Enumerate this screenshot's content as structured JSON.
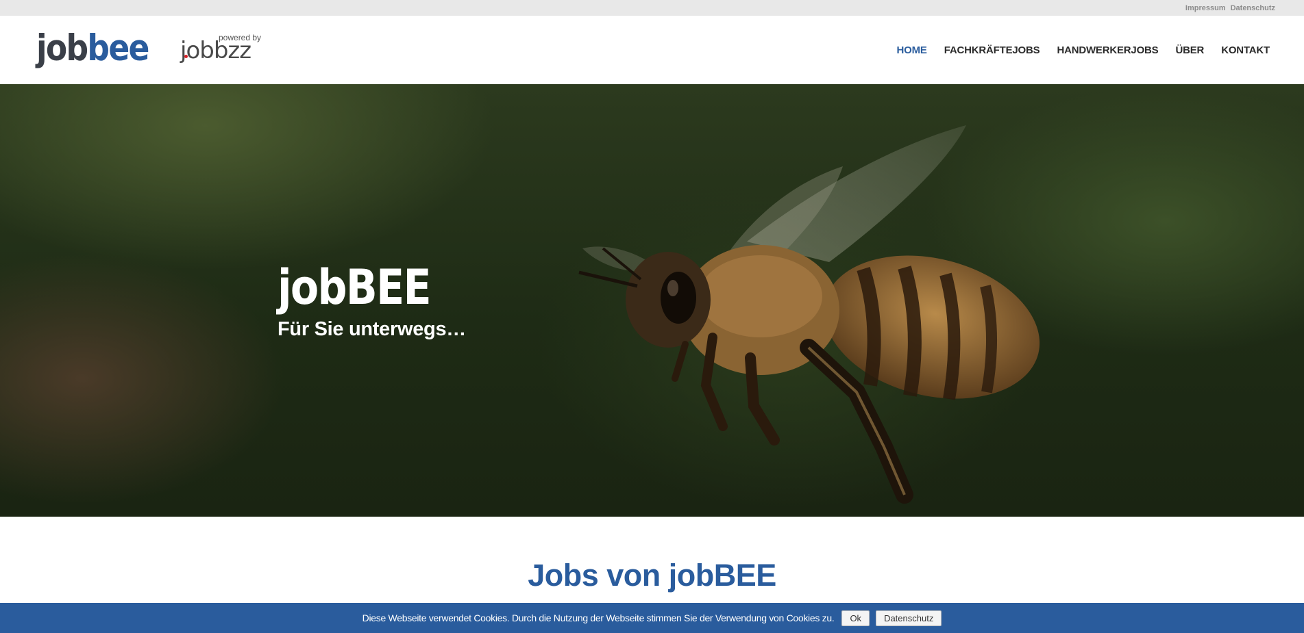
{
  "topbar": {
    "links": [
      "Impressum",
      "Datenschutz"
    ]
  },
  "header": {
    "logo": {
      "part1": "job",
      "part2": "bee"
    },
    "powered": {
      "by": "powered by",
      "brand": "jobbzz"
    },
    "nav": [
      {
        "label": "HOME",
        "active": true
      },
      {
        "label": "FACHKRÄFTEJOBS",
        "active": false
      },
      {
        "label": "HANDWERKERJOBS",
        "active": false
      },
      {
        "label": "ÜBER",
        "active": false
      },
      {
        "label": "KONTAKT",
        "active": false
      }
    ]
  },
  "hero": {
    "title": "jobBEE",
    "subtitle": "Für Sie unterwegs…",
    "image": "bee-in-flight"
  },
  "main": {
    "section_title": "Jobs von jobBEE"
  },
  "cookie_banner": {
    "text": "Diese Webseite verwendet Cookies. Durch die Nutzung der Webseite stimmen Sie der Verwendung von Cookies zu.",
    "ok_label": "Ok",
    "privacy_label": "Datenschutz"
  },
  "colors": {
    "brand_blue": "#2a5c9d",
    "logo_dark": "#3a3f48",
    "topbar_bg": "#e8e8e8"
  }
}
